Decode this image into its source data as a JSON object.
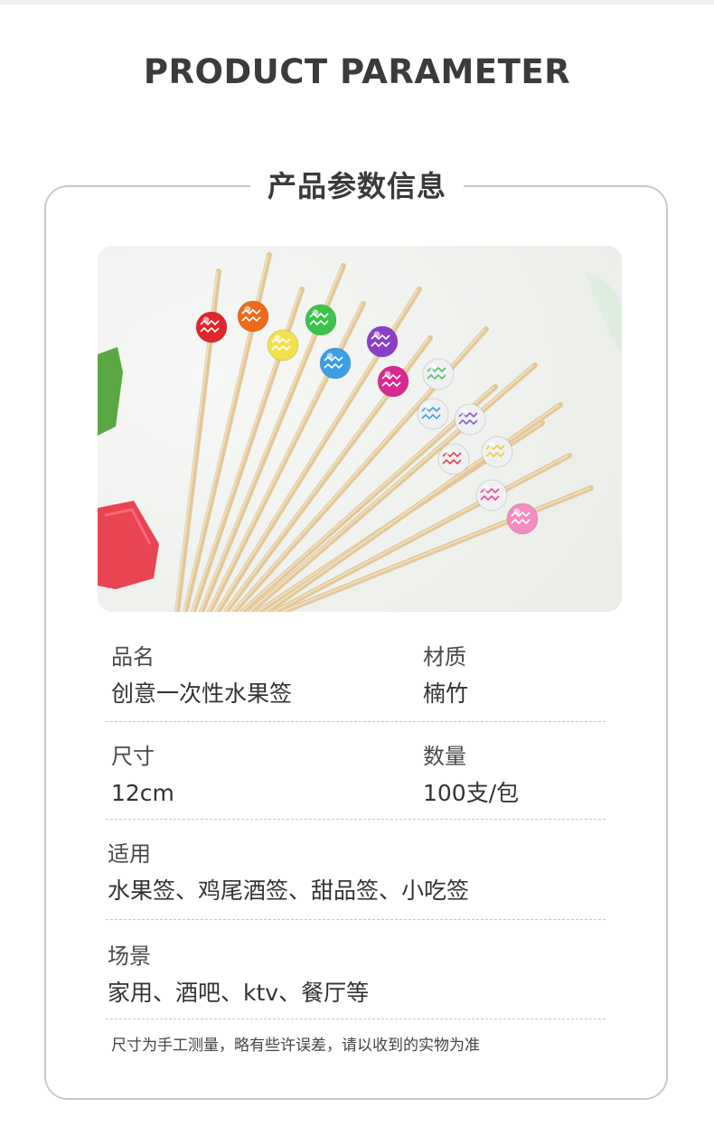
{
  "header": {
    "title": "PRODUCT PARAMETER"
  },
  "card": {
    "title": "产品参数信息"
  },
  "photo": {
    "subject": "bamboo fruit picks with colorful beads",
    "bead_colors": [
      "#e0252c",
      "#f06a1c",
      "#f3e04a",
      "#3cc34a",
      "#3b9ee6",
      "#8b3fc9",
      "#d9288f",
      "#eef0f2"
    ]
  },
  "params": {
    "name": {
      "label": "品名",
      "value": "创意一次性水果签"
    },
    "material": {
      "label": "材质",
      "value": "楠竹"
    },
    "size": {
      "label": "尺寸",
      "value": "12cm"
    },
    "quantity": {
      "label": "数量",
      "value": "100支/包"
    },
    "usage": {
      "label": "适用",
      "value": "水果签、鸡尾酒签、甜品签、小吃签"
    },
    "scene": {
      "label": "场景",
      "value": "家用、酒吧、ktv、餐厅等"
    }
  },
  "note": "尺寸为手工测量，略有些许误差，请以收到的实物为准"
}
